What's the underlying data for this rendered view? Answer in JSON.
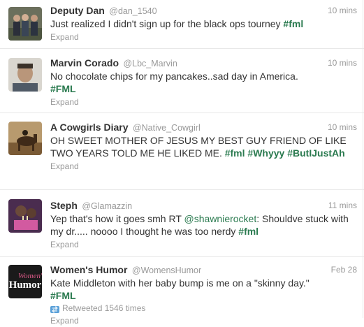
{
  "tweets": [
    {
      "fullname": "Deputy Dan",
      "username": "@dan_1540",
      "time": "10 mins",
      "text": "Just realized I didn't sign up for the black ops tourney ",
      "hashtag": "#fml",
      "expand": "Expand"
    },
    {
      "fullname": "Marvin Corado",
      "username": "@Lbc_Marvin",
      "time": "10 mins",
      "text": "No chocolate chips for my pancakes..sad day in America.",
      "hashtag": "#FML",
      "expand": "Expand"
    },
    {
      "fullname": "A Cowgirls Diary",
      "username": "@Native_Cowgirl",
      "time": "10 mins",
      "text": "OH SWEET MOTHER OF JESUS MY BEST GUY FRIEND OF LIKE TWO YEARS TOLD ME HE LIKED ME. ",
      "hashtag1": "#fml",
      "hashtag2": "#Whyyy",
      "hashtag3": "#ButIJustAh",
      "expand": "Expand"
    },
    {
      "fullname": "Steph",
      "username": "@Glamazzin",
      "time": "11 mins",
      "text_before": "Yep that's how it goes smh RT ",
      "mention": "@shawnierocket",
      "text_after": ": Shouldve stuck with my dr..... noooo I thought he was too nerdy ",
      "hashtag": "#fml",
      "expand": "Expand"
    },
    {
      "fullname": "Women's Humor",
      "username": "@WomensHumor",
      "time": "Feb 28",
      "text": "Kate Middleton with her baby bump is me on a \"skinny day.\"",
      "hashtag": "#FML",
      "retweeted": "Retweeted 1546 times",
      "expand": "Expand",
      "avatar_text_top": "Women's",
      "avatar_text_bottom": "Humor"
    }
  ],
  "colors": {
    "hashtag": "#2a7a4f",
    "meta": "#999999",
    "text": "#333333",
    "divider": "#e8e8e8"
  }
}
